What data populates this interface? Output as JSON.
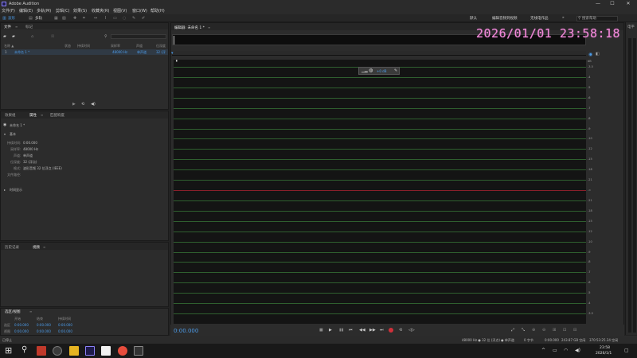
{
  "app": {
    "title": "Adobe Audition",
    "window_controls": {
      "minimize": "—",
      "maximize": "☐",
      "close": "✕"
    }
  },
  "menu": [
    "文件(F)",
    "编辑(E)",
    "多轨(M)",
    "剪辑(C)",
    "效果(S)",
    "收藏夹(R)",
    "视图(V)",
    "窗口(W)",
    "帮助(H)"
  ],
  "toolbar": {
    "view_waveform": "波形",
    "view_multitrack": "多轨",
    "workspaces": [
      "默认",
      "编辑音频到视频",
      "无线电作品"
    ],
    "more": "»",
    "search_placeholder": "搜索帮助"
  },
  "files_panel": {
    "tabs": [
      "文件",
      "标记"
    ],
    "columns": [
      "名称 ▲",
      "状态",
      "持续时间",
      "采样率",
      "声道",
      "位深度"
    ],
    "rows": [
      {
        "index": "1",
        "name": "未命名 1 *",
        "status": "",
        "duration": "",
        "sample_rate": "48000 Hz",
        "channels": "单声道",
        "bits": "32 (浮"
      }
    ],
    "footer_icons": [
      "play-icon",
      "loop-icon",
      "volume-icon"
    ]
  },
  "properties_panel": {
    "tabs": [
      "效果组",
      "属性",
      "匹配响度"
    ],
    "file_name": "未命名 1 *",
    "section_basic": "基本",
    "fields": [
      {
        "label": "持续时间:",
        "value": "0:00.000"
      },
      {
        "label": "采样率:",
        "value": "48000 Hz"
      },
      {
        "label": "声道:",
        "value": "单声道"
      },
      {
        "label": "位深度:",
        "value": "32 (浮点)"
      },
      {
        "label": "格式:",
        "value": "波形音频 32 位浮点 (IEEE)"
      },
      {
        "label": "文件路径:",
        "value": ""
      }
    ],
    "section_time": "时间显示"
  },
  "history_panel": {
    "tabs": [
      "历史记录",
      "视频"
    ]
  },
  "selection_panel": {
    "title": "选区/视图",
    "columns": [
      "开始",
      "结束",
      "持续时间"
    ],
    "rows": [
      {
        "label": "选区",
        "start": "0:00.000",
        "end": "0:00.000",
        "duration": "0:00.000"
      },
      {
        "label": "视图",
        "start": "0:00.000",
        "end": "0:00.000",
        "duration": "0:00.000"
      }
    ]
  },
  "editor": {
    "tab_label": "编辑器: 未命名 1 *",
    "hud_value": "+0 dB",
    "db_unit": "dB",
    "db_labels": [
      "-3.5",
      "-4",
      "-5",
      "-6",
      "-7",
      "-8",
      "-9",
      "-10",
      "-12",
      "-15",
      "-18",
      "-21",
      "-∞",
      "-21",
      "-18",
      "-15",
      "-12",
      "-10",
      "-9",
      "-8",
      "-7",
      "-6",
      "-5",
      "-4",
      "-3.5"
    ],
    "timecode": "0:00.000",
    "clock": "2026/01/01  23:58:18"
  },
  "meters": {
    "title": "电平"
  },
  "status": {
    "left": "已停止",
    "sample_info": "48000 Hz ● 32 位 (浮点) ● 单声道",
    "size": "0 字节",
    "duration": "0:00.000",
    "disk": "243.87 GB 空闲",
    "free_time": "370:53:25.34 空闲"
  },
  "taskbar": {
    "time": "23:58",
    "date": "2026/1/1"
  },
  "colors": {
    "accent": "#4c9be8",
    "clock": "#f08ad8",
    "gridline": "#2f5f2f",
    "record": "#d0303a"
  }
}
